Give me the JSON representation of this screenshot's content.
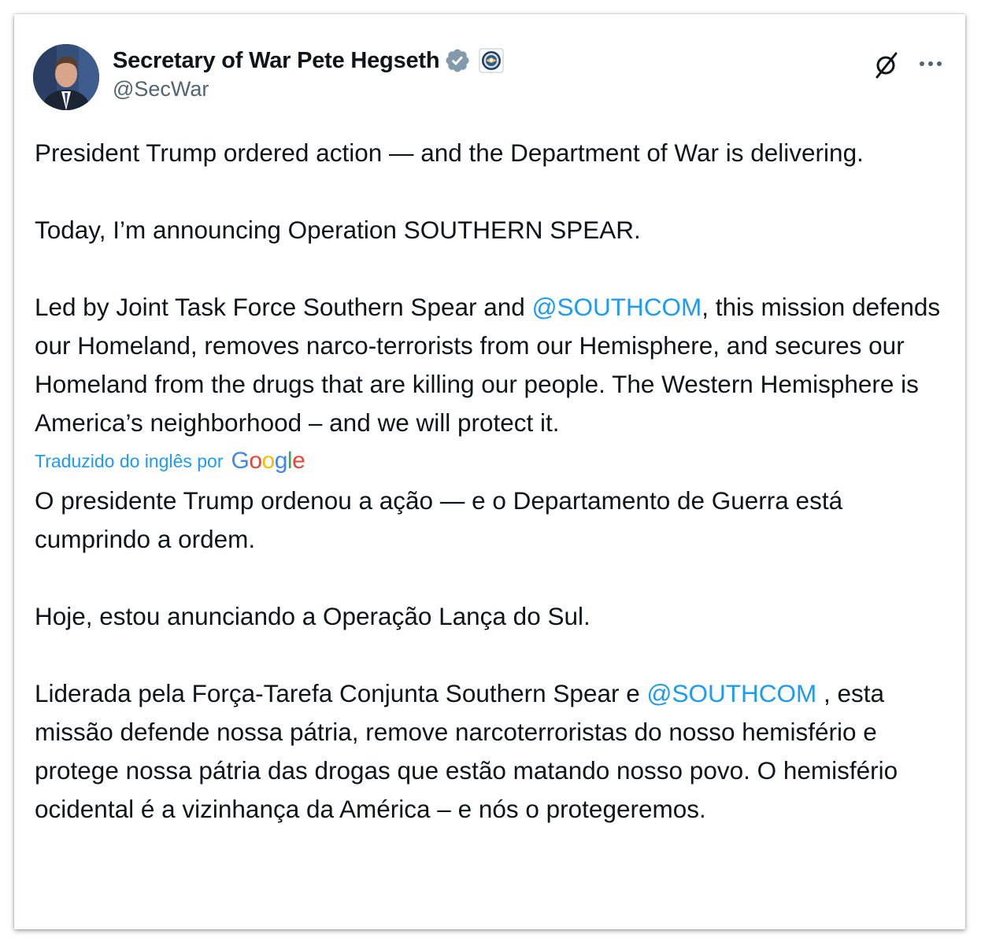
{
  "author": {
    "display_name": "Secretary of War Pete Hegseth",
    "handle": "@SecWar",
    "verified_icon": "verified-badge-icon",
    "affiliate_icon": "department-seal-icon"
  },
  "actions": {
    "grok_icon": "grok-icon",
    "more_icon": "more-options-icon"
  },
  "tweet": {
    "en_p1": "President Trump ordered action — and the Department of War is delivering.",
    "en_p2": "Today, I’m announcing Operation SOUTHERN SPEAR.",
    "en_p3_before": "Led by Joint Task Force Southern Spear and ",
    "en_p3_mention": "@SOUTHCOM",
    "en_p3_after": ", this mission defends our Homeland, removes narco-terrorists from our Hemisphere, and secures our Homeland from the drugs that are killing our people. The Western Hemisphere is America’s neighborhood – and we will protect it."
  },
  "translation": {
    "label": "Traduzido do inglês por",
    "provider": "Google",
    "pt_p1": "O presidente Trump ordenou a ação — e o Departamento de Guerra está cumprindo a ordem.",
    "pt_p2": "Hoje, estou anunciando a Operação Lança do Sul.",
    "pt_p3_before": "Liderada pela Força-Tarefa Conjunta Southern Spear e ",
    "pt_p3_mention": "@SOUTHCOM",
    "pt_p3_after": " , esta missão defende nossa pátria, remove narcoterroristas do nosso hemisfério e protege nossa pátria das drogas que estão matando nosso povo. O hemisfério ocidental é a vizinhança da América – e nós o protegeremos."
  },
  "colors": {
    "text": "#0f1419",
    "secondary": "#536471",
    "link": "#1d9bf0",
    "google_blue": "#4285f4",
    "google_red": "#ea4335",
    "google_yellow": "#fbbc05",
    "google_green": "#34a853"
  }
}
